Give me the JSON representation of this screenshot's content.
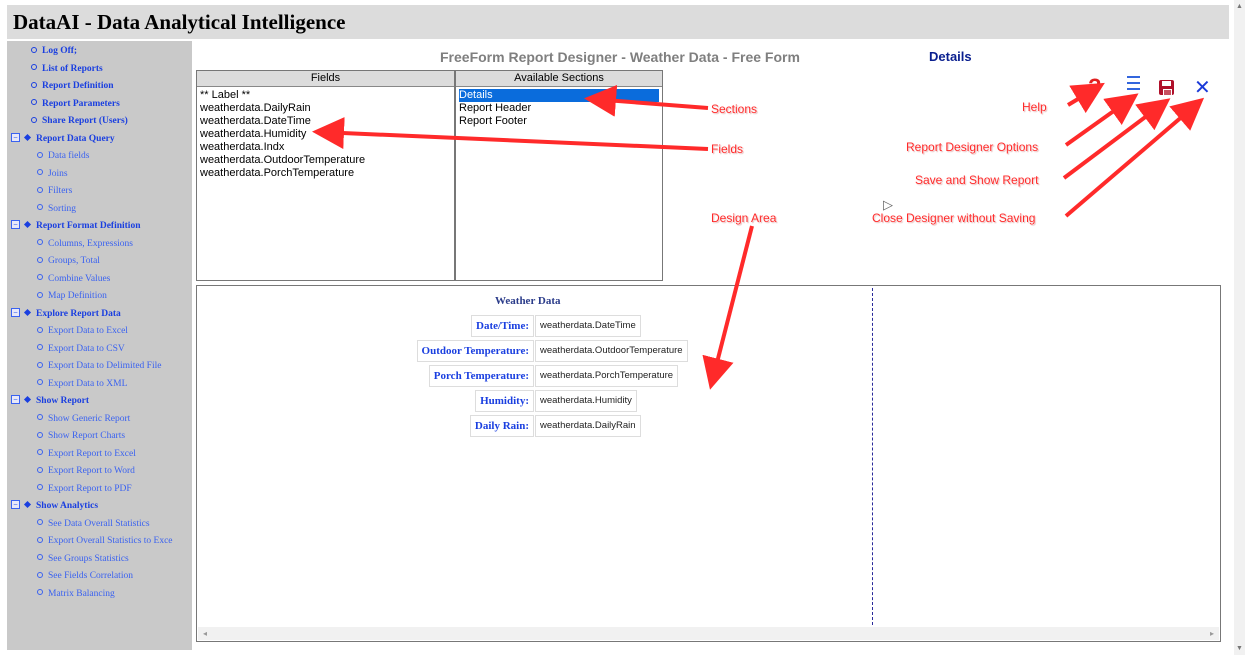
{
  "app": {
    "title": "DataAI - Data Analytical Intelligence"
  },
  "sidebar": {
    "items": [
      {
        "label": "Log Off;",
        "kind": "lvl1"
      },
      {
        "label": "List of Reports",
        "kind": "lvl1"
      },
      {
        "label": "Report Definition",
        "kind": "lvl1"
      },
      {
        "label": "Report Parameters",
        "kind": "lvl1"
      },
      {
        "label": "Share Report (Users)",
        "kind": "lvl1"
      },
      {
        "label": "Report Data Query",
        "kind": "group"
      },
      {
        "label": "Data fields",
        "kind": "lvl2"
      },
      {
        "label": "Joins",
        "kind": "lvl2"
      },
      {
        "label": "Filters",
        "kind": "lvl2"
      },
      {
        "label": "Sorting",
        "kind": "lvl2"
      },
      {
        "label": "Report Format Definition",
        "kind": "group"
      },
      {
        "label": "Columns, Expressions",
        "kind": "lvl2"
      },
      {
        "label": "Groups, Total",
        "kind": "lvl2"
      },
      {
        "label": "Combine Values",
        "kind": "lvl2"
      },
      {
        "label": "Map Definition",
        "kind": "lvl2"
      },
      {
        "label": "Explore Report Data",
        "kind": "group"
      },
      {
        "label": "Export Data to Excel",
        "kind": "lvl2"
      },
      {
        "label": "Export Data to CSV",
        "kind": "lvl2"
      },
      {
        "label": "Export Data to Delimited File",
        "kind": "lvl2"
      },
      {
        "label": "Export Data to XML",
        "kind": "lvl2"
      },
      {
        "label": "Show Report",
        "kind": "group"
      },
      {
        "label": "Show Generic Report",
        "kind": "lvl2"
      },
      {
        "label": "Show Report Charts",
        "kind": "lvl2"
      },
      {
        "label": "Export Report to Excel",
        "kind": "lvl2"
      },
      {
        "label": "Export Report to Word",
        "kind": "lvl2"
      },
      {
        "label": "Export Report to PDF",
        "kind": "lvl2"
      },
      {
        "label": "Show Analytics",
        "kind": "group"
      },
      {
        "label": "See Data Overall Statistics",
        "kind": "lvl2"
      },
      {
        "label": "Export Overall Statistics to Exce",
        "kind": "lvl2"
      },
      {
        "label": "See Groups Statistics",
        "kind": "lvl2"
      },
      {
        "label": "See Fields Correlation",
        "kind": "lvl2"
      },
      {
        "label": "Matrix Balancing",
        "kind": "lvl2"
      }
    ]
  },
  "designer": {
    "title": "FreeForm Report Designer - Weather Data - Free Form",
    "current_section": "Details"
  },
  "fields_panel": {
    "header": "Fields",
    "items": [
      "** Label **",
      "weatherdata.DailyRain",
      "weatherdata.DateTime",
      "weatherdata.Humidity",
      "weatherdata.Indx",
      "weatherdata.OutdoorTemperature",
      "weatherdata.PorchTemperature"
    ]
  },
  "sections_panel": {
    "header": "Available Sections",
    "items": [
      "Details",
      "Report Header",
      "Report Footer"
    ],
    "selected_index": 0
  },
  "form": {
    "title": "Weather Data",
    "rows": [
      {
        "label": "Date/Time:",
        "value": "weatherdata.DateTime"
      },
      {
        "label": "Outdoor Temperature:",
        "value": "weatherdata.OutdoorTemperature"
      },
      {
        "label": "Porch Temperature:",
        "value": "weatherdata.PorchTemperature"
      },
      {
        "label": "Humidity:",
        "value": "weatherdata.Humidity"
      },
      {
        "label": "Daily Rain:",
        "value": "weatherdata.DailyRain"
      }
    ]
  },
  "toolbar": {
    "help_glyph": "?",
    "close_glyph": "✕",
    "icons": [
      "help-icon",
      "options-menu-icon",
      "save-icon",
      "close-icon"
    ],
    "colors": {
      "help": "#e02020",
      "options": "#3366dd",
      "save": "#b0102a",
      "close": "#1b3ad8"
    }
  },
  "annotations": {
    "sections": "Sections",
    "fields": "Fields",
    "design_area": "Design Area",
    "help": "Help",
    "options": "Report Designer Options",
    "save": "Save and Show Report",
    "close": "Close Designer without Saving"
  },
  "colors": {
    "accent": "#1a3fe0",
    "annotation": "#ff2a2a",
    "selection": "#0a6cdc"
  }
}
